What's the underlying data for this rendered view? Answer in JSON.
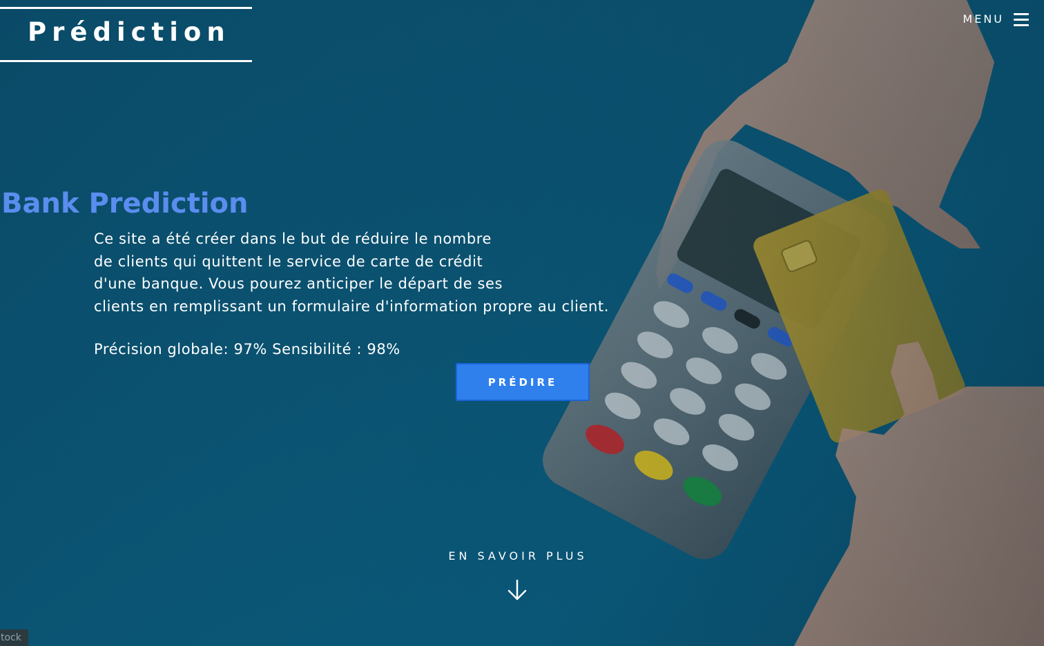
{
  "brand": {
    "title": "Prédiction"
  },
  "menu": {
    "label": "MENU",
    "icon": "hamburger-icon"
  },
  "hero": {
    "headline": "Bank Prediction",
    "intro_lines": [
      "Ce site a été créer dans le but de réduire le nombre",
      "de clients qui quittent le service de carte de crédit",
      "d'une banque. Vous pourez anticiper le départ de ses",
      "clients en remplissant un formulaire d'information propre au client."
    ],
    "metrics": "Précision globale: 97% Sensibilité : 98%",
    "predict_label": "PRÉDIRE",
    "learn_more": "EN SAVOIR PLUS",
    "learn_more_icon": "arrow-down-icon"
  },
  "footer": {
    "badge": "tock"
  },
  "colors": {
    "background": "#0b4f6c",
    "headline": "#5b8def",
    "button": "#2f80ed",
    "text": "#ffffff"
  }
}
